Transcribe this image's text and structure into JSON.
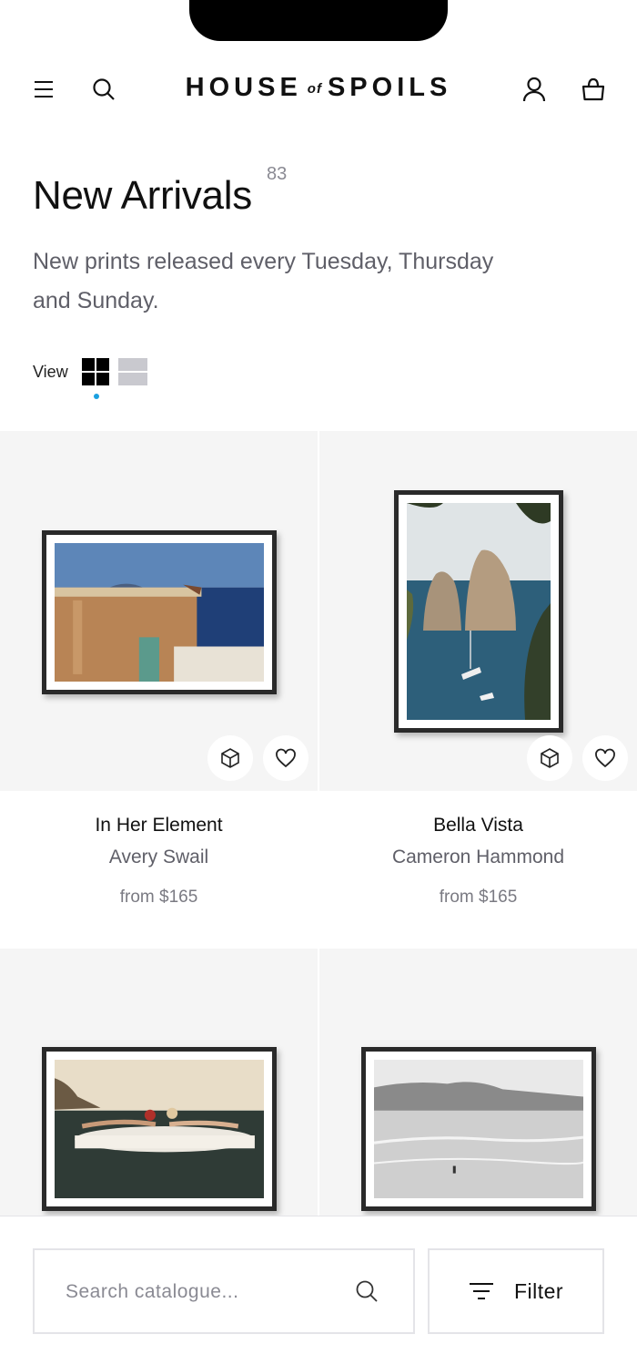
{
  "brand": {
    "name_left": "HOUSE",
    "name_mid": "of",
    "name_right": "SPOILS"
  },
  "header": {
    "menu_icon": "hamburger-menu-icon",
    "search_icon": "search-icon",
    "account_icon": "user-icon",
    "cart_icon": "shopping-bag-icon"
  },
  "page": {
    "title": "New Arrivals",
    "count": "83",
    "subtitle": "New prints released every Tuesday, Thursday and Sunday."
  },
  "view": {
    "label": "View",
    "options": [
      "grid-view-icon",
      "list-view-icon"
    ],
    "selected": "grid"
  },
  "products": [
    {
      "name": "In Her Element",
      "artist": "Avery Swail",
      "price": "from $165"
    },
    {
      "name": "Bella Vista",
      "artist": "Cameron Hammond",
      "price": "from $165"
    },
    {
      "name": "",
      "artist": "",
      "price": ""
    },
    {
      "name": "",
      "artist": "",
      "price": ""
    }
  ],
  "card_actions": {
    "ar_icon": "3d-cube-icon",
    "wishlist_icon": "heart-icon"
  },
  "bottom_bar": {
    "search_placeholder": "Search catalogue...",
    "search_value": "",
    "filter_label": "Filter",
    "filter_icon": "filter-lines-icon"
  },
  "colors": {
    "accent_dot": "#1aa0e0",
    "card_bg": "#f5f5f5",
    "text_muted": "#5f5f68"
  }
}
